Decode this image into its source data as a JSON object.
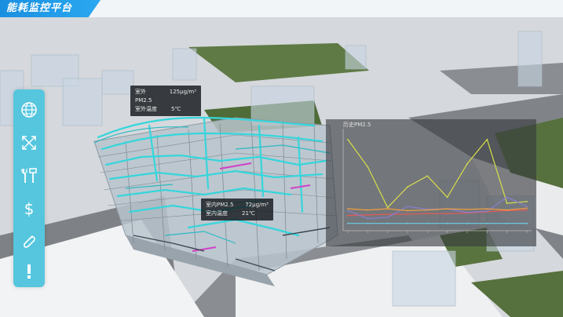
{
  "header": {
    "title": "能耗监控平台"
  },
  "sidebar": {
    "items": [
      {
        "name": "globe-icon"
      },
      {
        "name": "cross-arrows-icon"
      },
      {
        "name": "tools-icon"
      },
      {
        "name": "dollar-icon"
      },
      {
        "name": "paperclip-icon"
      },
      {
        "name": "alert-icon"
      }
    ]
  },
  "outdoor_info": {
    "pm_label": "室外PM2.5",
    "pm_value": "125μg/m³",
    "temp_label": "室外温度",
    "temp_value": "5℃"
  },
  "indoor_info": {
    "pm_label": "室内PM2.5",
    "pm_value": "72μg/m³",
    "temp_label": "室内温度",
    "temp_value": "21℃"
  },
  "chart_panel": {
    "title": "历史PM2.5"
  },
  "chart_data": {
    "type": "line",
    "title": "历史PM2.5",
    "xlabel": "",
    "ylabel": "",
    "x": [
      "1",
      "2",
      "3",
      "4",
      "5",
      "6",
      "7",
      "8",
      "9",
      "10"
    ],
    "ylim": [
      0,
      160
    ],
    "series": [
      {
        "color": "#d8e04a",
        "values": [
          150,
          105,
          38,
          72,
          90,
          55,
          110,
          150,
          45,
          48
        ]
      },
      {
        "color": "#e65a5a",
        "values": [
          25,
          26,
          27,
          27,
          28,
          28,
          29,
          31,
          33,
          34
        ]
      },
      {
        "color": "#8a7fd0",
        "values": [
          33,
          20,
          22,
          40,
          35,
          36,
          30,
          32,
          55,
          40
        ]
      },
      {
        "color": "#f0a040",
        "values": [
          36,
          34,
          36,
          33,
          34,
          36,
          35,
          36,
          34,
          37
        ]
      },
      {
        "color": "#6ad0e8",
        "values": [
          12,
          12,
          12,
          12,
          12,
          12,
          12,
          12,
          12,
          12
        ]
      }
    ],
    "grid": false,
    "colors": {
      "accent": "#1a8fe0",
      "sidebar": "#55c6de"
    }
  }
}
